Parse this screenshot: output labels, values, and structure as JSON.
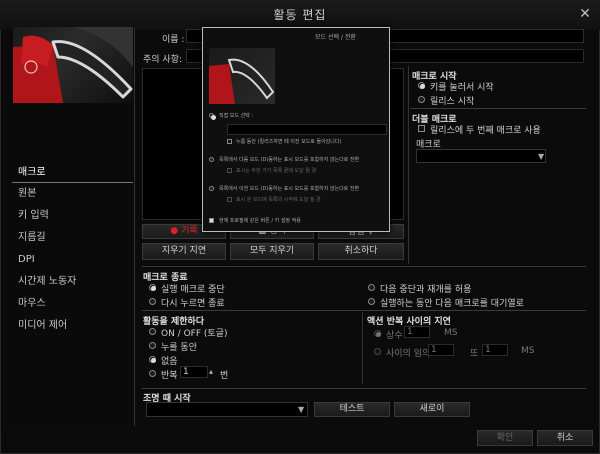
{
  "window": {
    "title": "활동 편집",
    "close": "✕"
  },
  "sidebar": {
    "items": [
      {
        "label": "매크로",
        "active": true
      },
      {
        "label": "원본"
      },
      {
        "label": "키 입력"
      },
      {
        "label": "지름길"
      },
      {
        "label": "DPI"
      },
      {
        "label": "시간제 노동자"
      },
      {
        "label": "마우스"
      },
      {
        "label": "미디어 제어"
      }
    ]
  },
  "form": {
    "name_label": "이름 :",
    "note_label": "주의 사항:"
  },
  "record": {
    "record_label": "● 기록",
    "stop_label": "■ 정지",
    "insert_label": "삽입",
    "clear_delay": "지우기 지연",
    "clear_all": "모두 지우기",
    "cancel": "취소하다"
  },
  "macro_start": {
    "title": "매크로 시작",
    "opt_press": "키를 눌러서 시작",
    "opt_release": "릴리스 시작"
  },
  "double_macro": {
    "title": "더블 매크로",
    "check_label": "릴리스에 두 번째 매크로 사용",
    "macro_label": "매크로"
  },
  "macro_end": {
    "title": "매크로 종료",
    "opt_stop": "실행 매크로 중단",
    "opt_repress": "다시 누르면 종료",
    "opt_resume": "다음 중단과 재개를 허용",
    "opt_wait": "실행하는 동안 다음 매크로를 대기열로"
  },
  "limit": {
    "title": "활동을 제한하다",
    "opt_onoff": "ON / OFF (토글)",
    "opt_hold": "누를 동안",
    "opt_none": "없음",
    "opt_repeat": "반복",
    "repeat_value": "1",
    "repeat_unit": "번"
  },
  "delay": {
    "title": "액션 반복 사이의 지연",
    "opt_const": "상수",
    "const_value": "1",
    "ms1": "MS",
    "opt_between": "사이의 임의",
    "min_value": "1",
    "and_label": "또",
    "max_value": "1",
    "ms2": "MS"
  },
  "lighting": {
    "title": "조명 때 시작",
    "test": "테스트",
    "refresh": "새로이"
  },
  "footer": {
    "ok": "확인",
    "cancel": "취소"
  },
  "popup": {
    "header": "모드 선택 / 전환",
    "opt1": "직접 모드 선택 :",
    "chk1": "누름 동안 (릴리즈하면 때 이전 모드로 돌아감니다)",
    "opt2": "목록에서 다음 모드 (D)동하는 표시 모드를 포함하지 않는다로 전환",
    "sub2": "표시는 두번 가기 목록 끝에 도달 될 경",
    "opt3": "목록에서 이전 모드 (D)동하는 표시 모드를 포함하지 않는다로 전환",
    "sub3": "표시 된 모드에 목록의 시작에 도달 될 경",
    "chk_bottom": "현재 프로필에 같은 버튼 / 키 설정 적용"
  },
  "colors": {
    "record": "#e02020",
    "bg": "#0b0b0b",
    "accent": "#d0d0d0"
  }
}
